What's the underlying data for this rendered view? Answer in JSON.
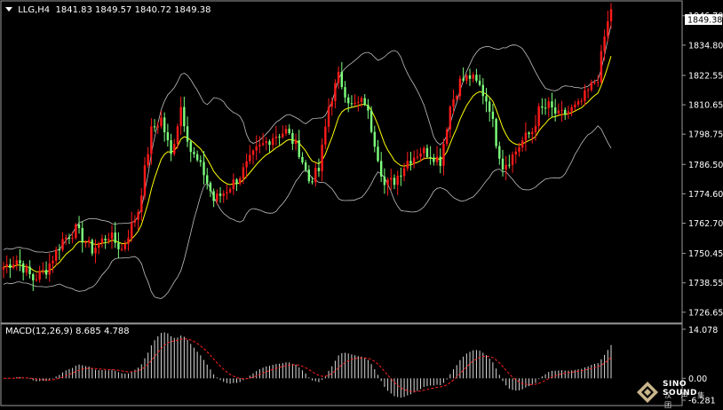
{
  "header": {
    "symbol": "LLG,H4",
    "open": "1841.83",
    "high": "1849.57",
    "low": "1840.72",
    "close": "1849.38"
  },
  "macd": {
    "label": "MACD(12,26,9)",
    "value": "8.685",
    "signal": "4.788"
  },
  "logo": {
    "name": "SINO SOUND",
    "chinese": "汉 声 集 团"
  },
  "colors": {
    "background": "#000000",
    "bull": "#ff1a1a",
    "bear": "#7cff7c",
    "ma": "#ffff00",
    "band": "#bfbfbf",
    "macd_hist": "#d9d9d9",
    "macd_signal": "#ff2020"
  },
  "chart_data": {
    "type": "candlestick",
    "instrument": "LLG",
    "timeframe": "H4",
    "price_axis": {
      "ticks": [
        "1846.70",
        "1834.80",
        "1822.55",
        "1810.65",
        "1798.75",
        "1786.50",
        "1774.60",
        "1762.70",
        "1750.45",
        "1738.55",
        "1726.65"
      ],
      "range": [
        1723,
        1852
      ],
      "current_price_label": "1849.38"
    },
    "macd_axis": {
      "ticks": [
        "14.078",
        "0.00",
        "-6.281"
      ],
      "range": [
        -6.281,
        14.078
      ]
    },
    "close_path": [
      [
        0,
        1745
      ],
      [
        4,
        1748
      ],
      [
        9,
        1740
      ],
      [
        13,
        1744
      ],
      [
        18,
        1756
      ],
      [
        22,
        1760
      ],
      [
        27,
        1752
      ],
      [
        32,
        1758
      ],
      [
        36,
        1752
      ],
      [
        41,
        1768
      ],
      [
        45,
        1800
      ],
      [
        48,
        1805
      ],
      [
        51,
        1790
      ],
      [
        54,
        1810
      ],
      [
        57,
        1792
      ],
      [
        61,
        1783
      ],
      [
        64,
        1772
      ],
      [
        67,
        1775
      ],
      [
        72,
        1782
      ],
      [
        77,
        1792
      ],
      [
        82,
        1798
      ],
      [
        86,
        1800
      ],
      [
        90,
        1792
      ],
      [
        93,
        1780
      ],
      [
        96,
        1784
      ],
      [
        99,
        1810
      ],
      [
        102,
        1822
      ],
      [
        106,
        1810
      ],
      [
        110,
        1812
      ],
      [
        113,
        1796
      ],
      [
        116,
        1778
      ],
      [
        119,
        1780
      ],
      [
        123,
        1788
      ],
      [
        127,
        1792
      ],
      [
        130,
        1791
      ],
      [
        133,
        1788
      ],
      [
        136,
        1810
      ],
      [
        139,
        1820
      ],
      [
        142,
        1822
      ],
      [
        145,
        1818
      ],
      [
        148,
        1810
      ],
      [
        150,
        1796
      ],
      [
        152,
        1786
      ],
      [
        155,
        1790
      ],
      [
        158,
        1796
      ],
      [
        161,
        1800
      ],
      [
        163,
        1808
      ],
      [
        166,
        1810
      ],
      [
        169,
        1806
      ],
      [
        172,
        1808
      ],
      [
        175,
        1810
      ],
      [
        178,
        1816
      ],
      [
        181,
        1822
      ],
      [
        183,
        1838
      ],
      [
        185,
        1849.38
      ]
    ]
  }
}
